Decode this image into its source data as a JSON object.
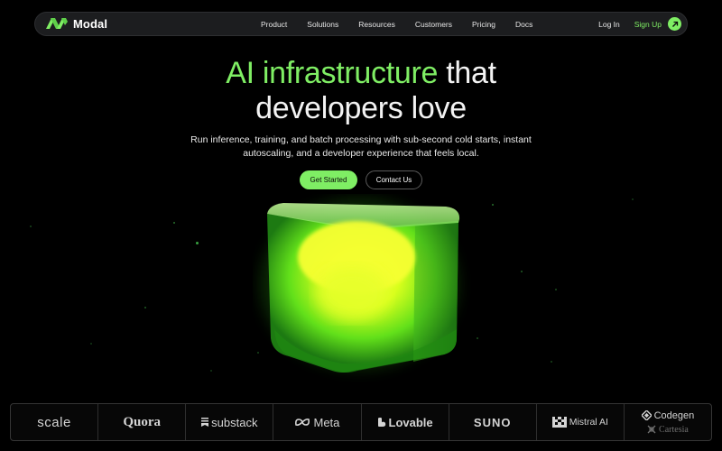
{
  "brand": {
    "name": "Modal",
    "accent": "#7fee64"
  },
  "nav": {
    "links": [
      "Product",
      "Solutions",
      "Resources",
      "Customers",
      "Pricing",
      "Docs"
    ],
    "login": "Log In",
    "signup": "Sign Up"
  },
  "hero": {
    "title_accent": "AI infrastructure",
    "title_rest_line1": "that",
    "title_line2": "developers love",
    "subtitle": "Run inference, training, and batch processing with sub-second cold starts, instant autoscaling, and a developer experience that feels local.",
    "primary_cta": "Get Started",
    "secondary_cta": "Contact Us"
  },
  "customers": {
    "logos": [
      "scale",
      "Quora",
      "substack",
      "Meta",
      "Lovable",
      "SUNO",
      "Mistral AI",
      "Codegen",
      "Cartesia"
    ]
  }
}
